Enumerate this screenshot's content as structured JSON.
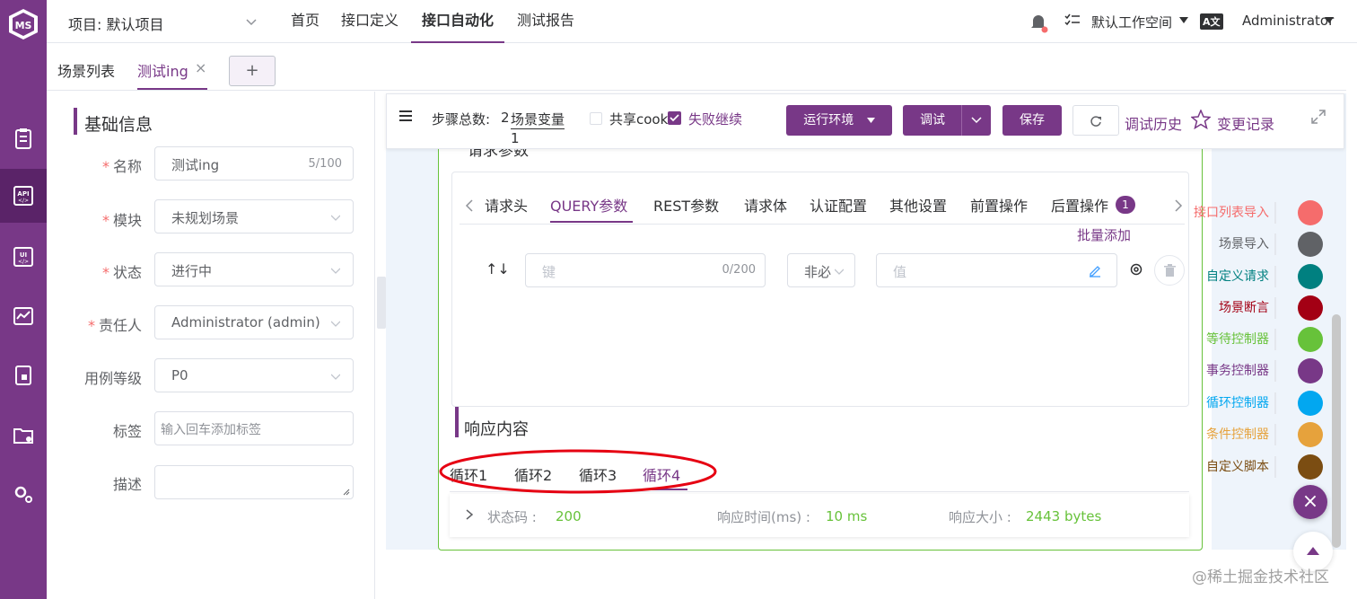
{
  "header": {
    "project_label": "项目: 默认项目",
    "nav": [
      "首页",
      "接口定义",
      "接口自动化",
      "测试报告"
    ],
    "workspace": "默认工作空间",
    "lang_icon": "A文",
    "user": "Administrator"
  },
  "tabs": {
    "list_label": "场景列表",
    "current_label": "测试ing",
    "close": "×",
    "add": "+"
  },
  "basic_info": {
    "title": "基础信息",
    "fields": {
      "name_label": "名称",
      "name_value": "测试ing",
      "name_count": "5/100",
      "module_label": "模块",
      "module_value": "未规划场景",
      "status_label": "状态",
      "status_value": "进行中",
      "owner_label": "责任人",
      "owner_value": "Administrator (admin)",
      "level_label": "用例等级",
      "level_value": "P0",
      "tag_label": "标签",
      "tag_placeholder": "输入回车添加标签",
      "desc_label": "描述"
    }
  },
  "toolbar": {
    "step_total_label": "步骤总数:",
    "step_total_value": "2",
    "step_total_value2": "1",
    "scene_var": "场景变量",
    "share_cookie": "共享cook",
    "continue_on_fail": "失败继续",
    "run_env": "运行环境",
    "debug": "调试",
    "save": "保存",
    "debug_history": "调试历史",
    "change_log": "变更记录"
  },
  "request": {
    "section_title": "请求参数",
    "tabs": [
      "请求头",
      "QUERY参数",
      "REST参数",
      "请求体",
      "认证配置",
      "其他设置",
      "前置操作",
      "后置操作"
    ],
    "post_op_badge": "1",
    "batch_add": "批量添加",
    "key_placeholder": "键",
    "key_count": "0/200",
    "required_value": "非必",
    "value_placeholder": "值"
  },
  "response": {
    "title": "响应内容",
    "loops": [
      "循环1",
      "循环2",
      "循环3",
      "循环4"
    ],
    "status_label": "状态码 :",
    "status_value": "200",
    "time_label": "响应时间(ms) :",
    "time_value": "10 ms",
    "size_label": "响应大小 :",
    "size_value": "2443 bytes"
  },
  "widgets": [
    {
      "label": "接口列表导入",
      "color": "#f56c6c"
    },
    {
      "label": "场景导入",
      "color": "#606266"
    },
    {
      "label": "自定义请求",
      "color": "#008080"
    },
    {
      "label": "场景断言",
      "color": "#a30014"
    },
    {
      "label": "等待控制器",
      "color": "#67c23a"
    },
    {
      "label": "事务控制器",
      "color": "#783887"
    },
    {
      "label": "循环控制器",
      "color": "#02a7f0"
    },
    {
      "label": "条件控制器",
      "color": "#e6a23c"
    },
    {
      "label": "自定义脚本",
      "color": "#7b4d12"
    }
  ],
  "watermark": "@稀土掘金技术社区",
  "colors": {
    "brand": "#783887",
    "success": "#67c23a",
    "annotation": "#e60012"
  }
}
